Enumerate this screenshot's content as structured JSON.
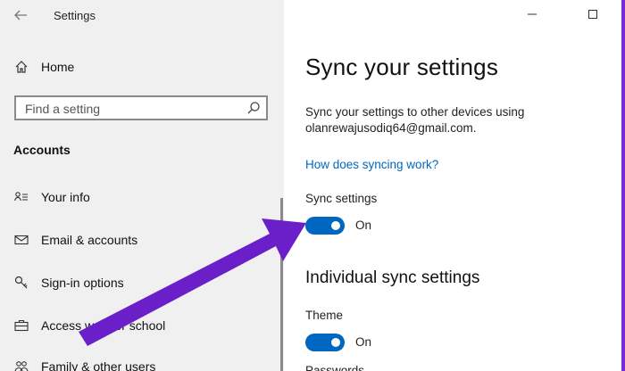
{
  "window": {
    "title": "Settings"
  },
  "sidebar": {
    "home_label": "Home",
    "search": {
      "placeholder": "Find a setting"
    },
    "section_title": "Accounts",
    "items": [
      {
        "label": "Your info"
      },
      {
        "label": "Email & accounts"
      },
      {
        "label": "Sign-in options"
      },
      {
        "label": "Access work or school"
      },
      {
        "label": "Family & other users"
      }
    ]
  },
  "main": {
    "title": "Sync your settings",
    "description": "Sync your settings to other devices using olanrewajusodiq64@gmail.com.",
    "link": "How does syncing work?",
    "sync_settings": {
      "label": "Sync settings",
      "state": "On"
    },
    "individual_title": "Individual sync settings",
    "theme": {
      "label": "Theme",
      "state": "On"
    },
    "next_label": "Passwords"
  },
  "colors": {
    "accent": "#0067c0",
    "annotation_arrow": "#6a1fc9",
    "frame": "#7a2bd8"
  }
}
